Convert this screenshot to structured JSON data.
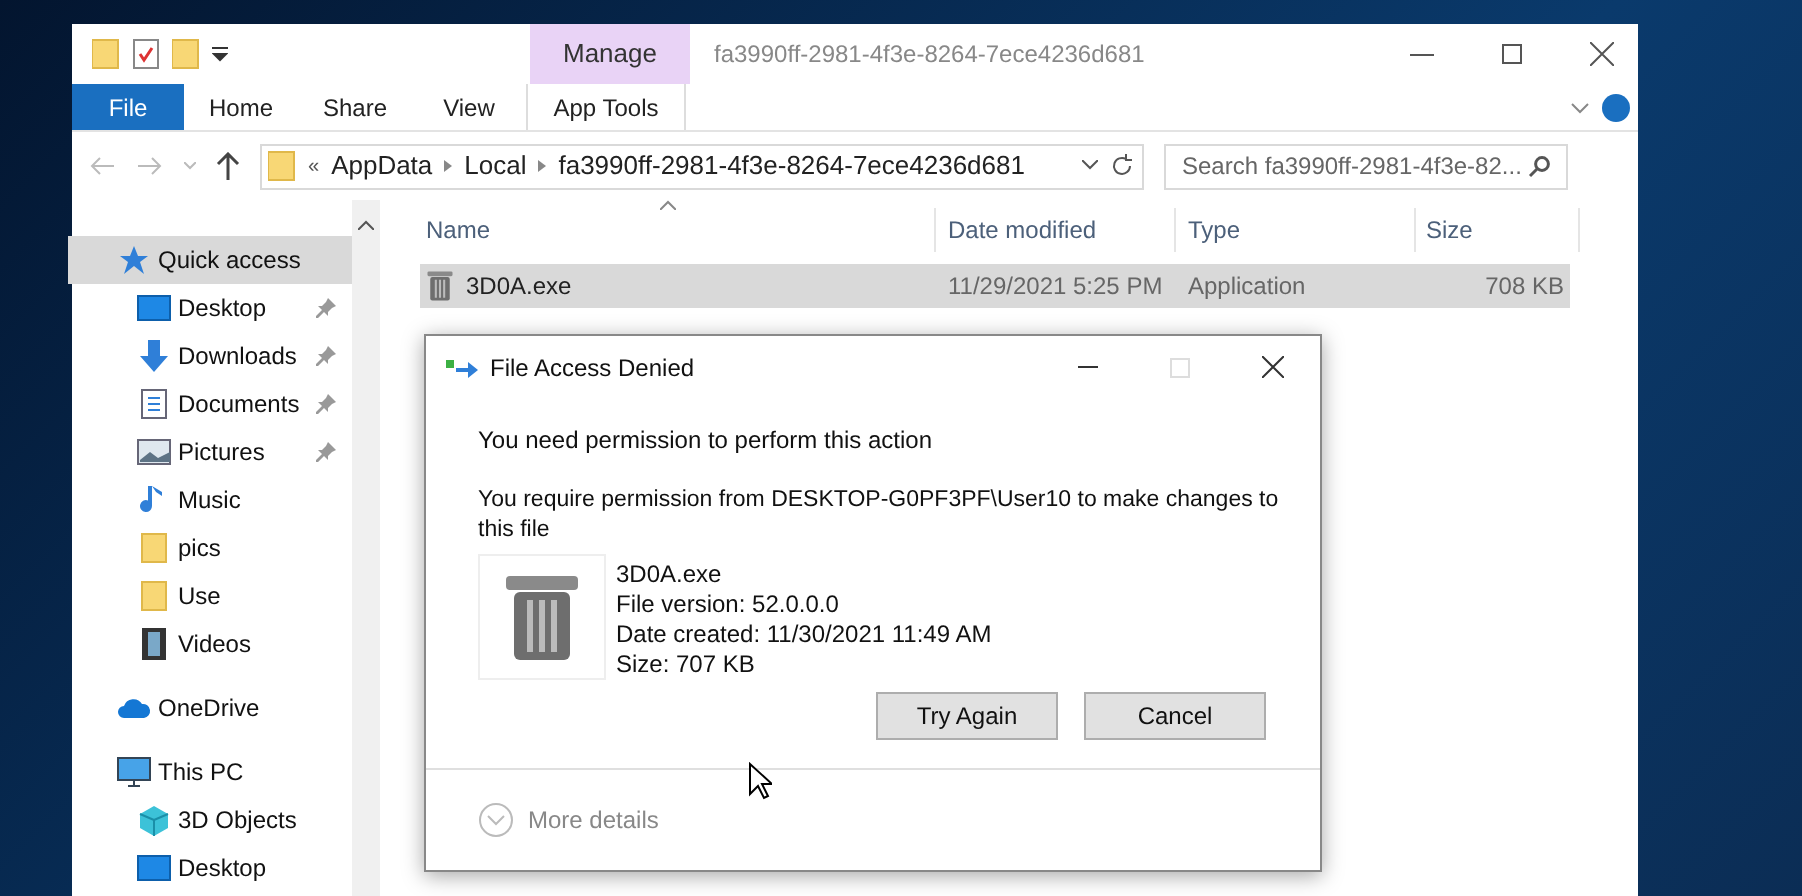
{
  "explorer": {
    "contextual_tab": "Manage",
    "title": "fa3990ff-2981-4f3e-8264-7ece4236d681",
    "ribbon_tabs": [
      {
        "label": "File",
        "kind": "file"
      },
      {
        "label": "Home",
        "kind": "tab"
      },
      {
        "label": "Share",
        "kind": "tab"
      },
      {
        "label": "View",
        "kind": "tab"
      },
      {
        "label": "App Tools",
        "kind": "contextual"
      }
    ],
    "breadcrumb_overflow": "«",
    "breadcrumb": [
      "AppData",
      "Local",
      "fa3990ff-2981-4f3e-8264-7ece4236d681"
    ],
    "search": {
      "placeholder": "Search fa3990ff-2981-4f3e-82..."
    },
    "sidebar": [
      {
        "label": "Quick access",
        "kind": "star",
        "selected": true,
        "children": [
          {
            "label": "Desktop",
            "kind": "desktop",
            "pinned": true,
            "selected": false
          },
          {
            "label": "Downloads",
            "kind": "download",
            "pinned": true,
            "selected": false
          },
          {
            "label": "Documents",
            "kind": "document",
            "pinned": true,
            "selected": false
          },
          {
            "label": "Pictures",
            "kind": "pictures",
            "pinned": true,
            "selected": false
          },
          {
            "label": "Music",
            "kind": "music",
            "pinned": false,
            "selected": false
          },
          {
            "label": "pics",
            "kind": "folder",
            "pinned": false,
            "selected": false
          },
          {
            "label": "Use",
            "kind": "folder",
            "pinned": false,
            "selected": false
          },
          {
            "label": "Videos",
            "kind": "videos",
            "pinned": false,
            "selected": false
          }
        ]
      },
      {
        "label": "OneDrive",
        "kind": "cloud",
        "selected": false
      },
      {
        "label": "This PC",
        "kind": "pc",
        "selected": false,
        "children": [
          {
            "label": "3D Objects",
            "kind": "cube",
            "pinned": false,
            "selected": false
          },
          {
            "label": "Desktop",
            "kind": "desktop",
            "pinned": false,
            "selected": false
          }
        ]
      }
    ],
    "columns": [
      {
        "label": "Name",
        "sorted": true
      },
      {
        "label": "Date modified",
        "sorted": false
      },
      {
        "label": "Type",
        "sorted": false
      },
      {
        "label": "Size",
        "sorted": false
      }
    ],
    "rows": [
      {
        "name": "3D0A.exe",
        "date": "11/29/2021 5:25 PM",
        "type": "Application",
        "size": "708 KB",
        "selected": true
      }
    ]
  },
  "dialog": {
    "title": "File Access Denied",
    "maximize_disabled": true,
    "heading": "You need permission to perform this action",
    "message": "You require permission from DESKTOP-G0PF3PF\\User10 to make changes to this file",
    "file": [
      "3D0A.exe",
      "File version: 52.0.0.0",
      "Date created: 11/30/2021 11:49 AM",
      "Size: 707 KB"
    ],
    "buttons": [
      "Try Again",
      "Cancel"
    ],
    "more_details": "More details"
  }
}
